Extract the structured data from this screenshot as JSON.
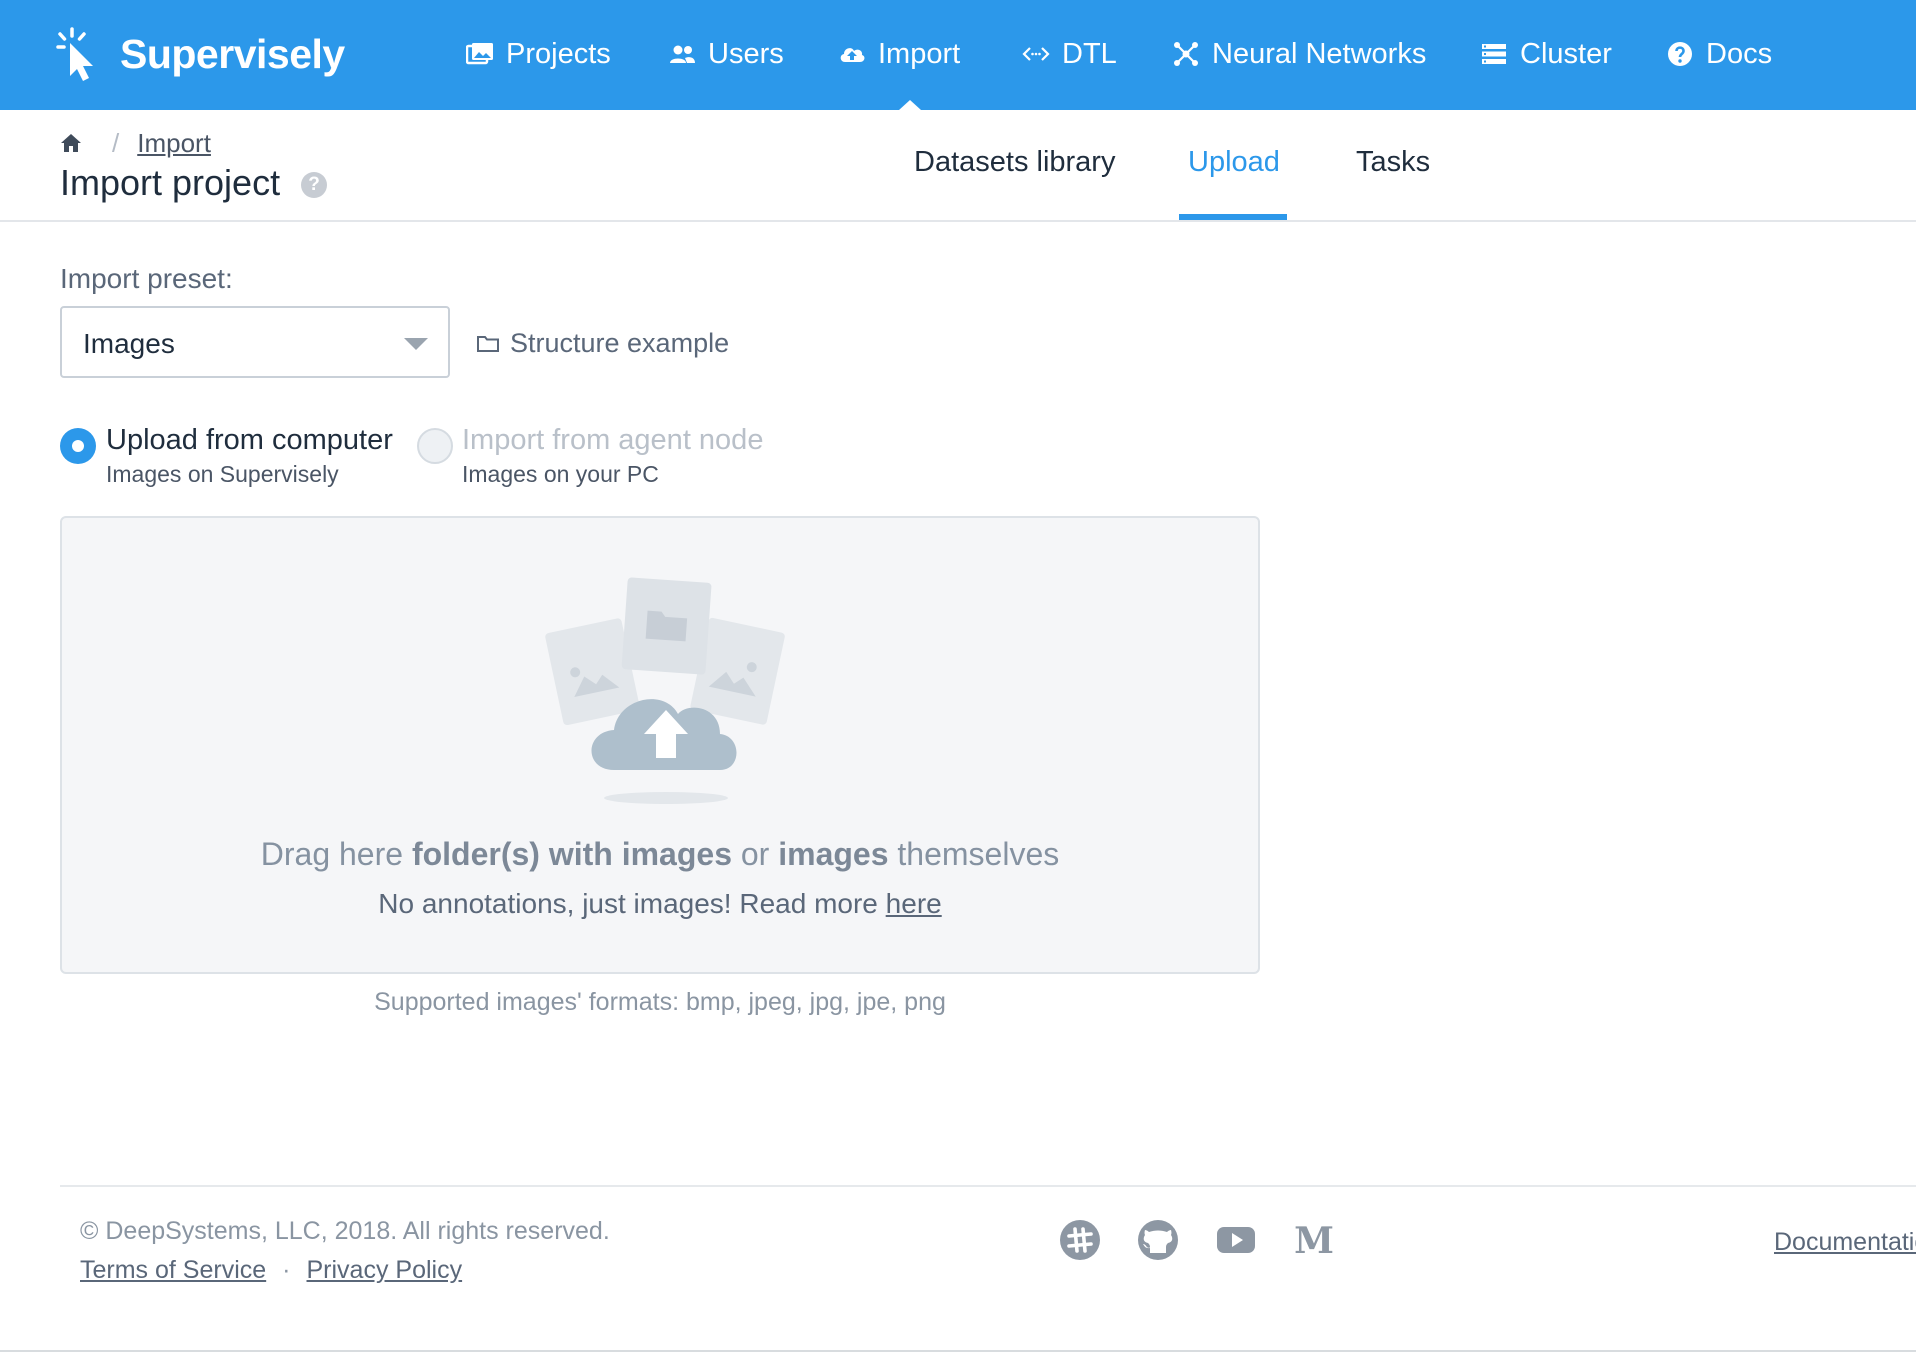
{
  "brand": {
    "name": "Supervisely",
    "icon": "cursor-burst-logo"
  },
  "nav": {
    "items": [
      {
        "label": "Projects",
        "icon": "images-icon",
        "active": false
      },
      {
        "label": "Users",
        "icon": "users-icon",
        "active": false
      },
      {
        "label": "Import",
        "icon": "cloud-upload-icon",
        "active": true
      },
      {
        "label": "DTL",
        "icon": "code-icon",
        "active": false
      },
      {
        "label": "Neural Networks",
        "icon": "network-icon",
        "active": false
      },
      {
        "label": "Cluster",
        "icon": "server-list-icon",
        "active": false
      },
      {
        "label": "Docs",
        "icon": "question-circle-icon",
        "active": false
      }
    ]
  },
  "breadcrumb": {
    "home_icon": "home-icon",
    "separator": "/",
    "current": "Import"
  },
  "page": {
    "title": "Import project",
    "help_icon": "?"
  },
  "tabs": [
    {
      "label": "Datasets library",
      "active": false
    },
    {
      "label": "Upload",
      "active": true
    },
    {
      "label": "Tasks",
      "active": false
    }
  ],
  "form": {
    "preset_label": "Import preset:",
    "preset_value": "Images",
    "structure_link": "Structure example",
    "upload_options": [
      {
        "title": "Upload from computer",
        "subtitle": "Images on Supervisely",
        "checked": true,
        "disabled": false
      },
      {
        "title": "Import from agent node",
        "subtitle": "Images on your PC",
        "checked": false,
        "disabled": true
      }
    ]
  },
  "dropzone": {
    "line1_prefix": "Drag here ",
    "line1_bold1": "folder(s) with images",
    "line1_mid": " or ",
    "line1_bold2": "images",
    "line1_suffix": " themselves",
    "line2_prefix": "No annotations, just images! Read more ",
    "line2_link": "here"
  },
  "formats": "Supported images' formats: bmp, jpeg, jpg, jpe, png",
  "footer": {
    "copyright": "© DeepSystems, LLC, 2018. All rights reserved.",
    "terms": "Terms of Service",
    "separator": "·",
    "privacy": "Privacy Policy",
    "socials": [
      "slack-icon",
      "github-icon",
      "youtube-icon",
      "medium-icon"
    ],
    "docs_link": "Documentation"
  },
  "colors": {
    "primary": "#2c98ea",
    "text": "#1f2d3d",
    "muted": "#8a95a2"
  }
}
